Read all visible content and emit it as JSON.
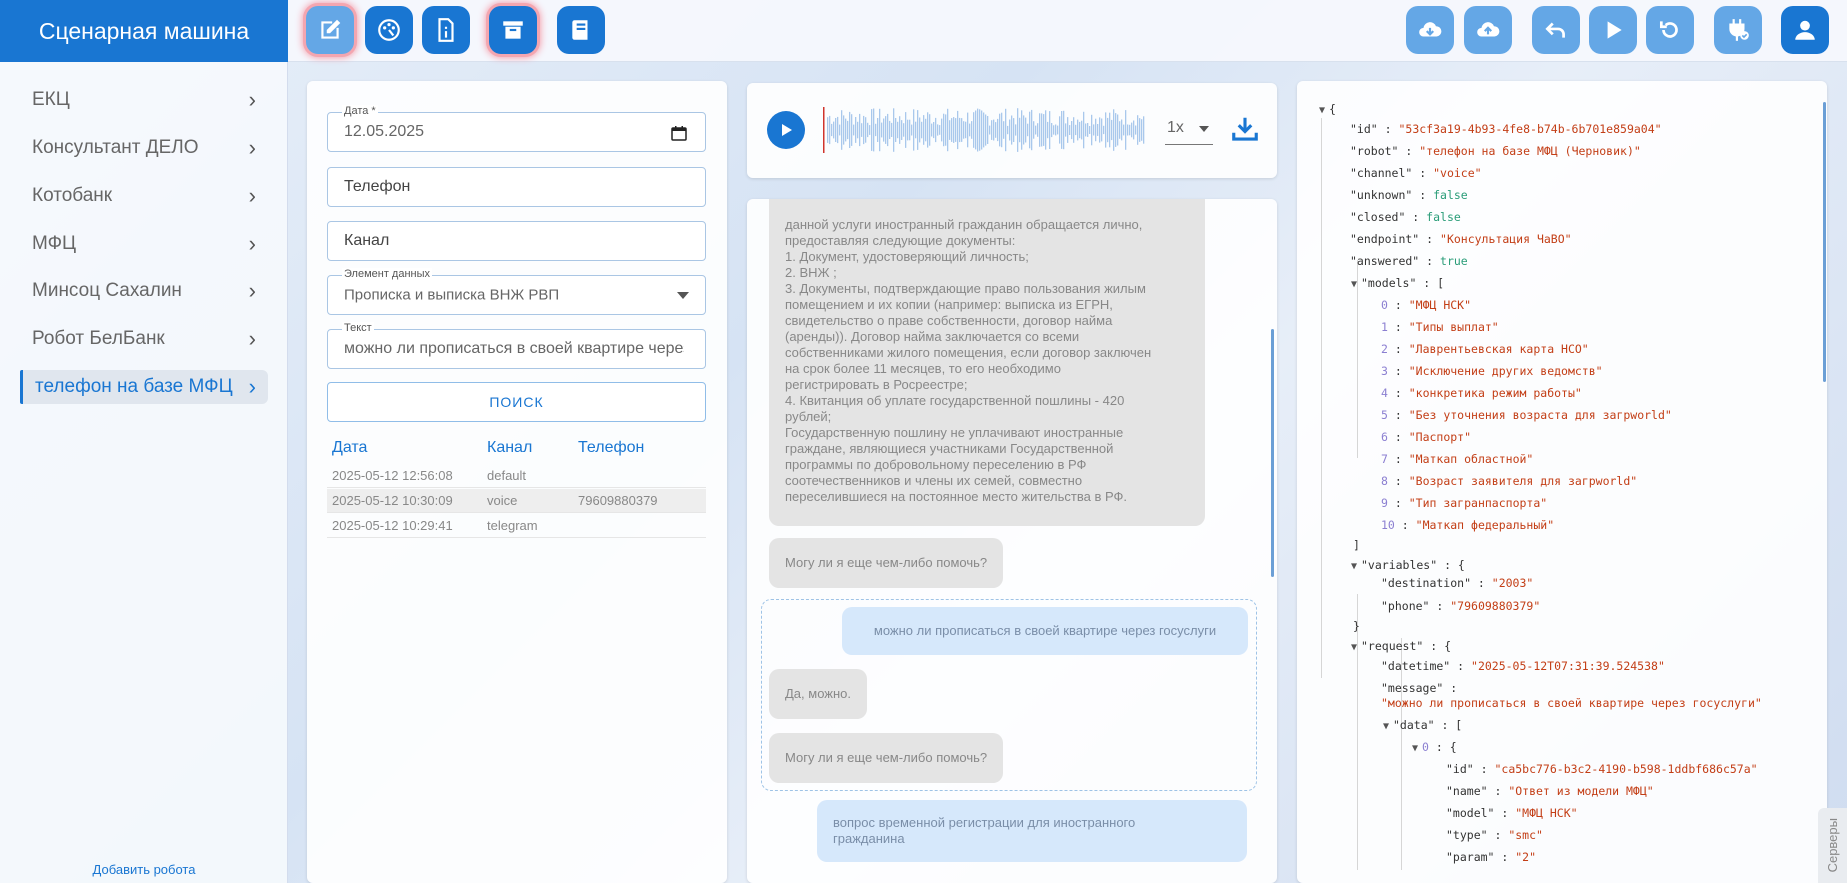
{
  "app": {
    "title": "Сценарная машина"
  },
  "sidebar": {
    "items": [
      {
        "label": "ЕКЦ"
      },
      {
        "label": "Консультант ДЕЛО"
      },
      {
        "label": "Котобанк"
      },
      {
        "label": "МФЦ"
      },
      {
        "label": "Минсоц Сахалин"
      },
      {
        "label": "Робот БелБанк"
      },
      {
        "label": "телефон на базе МФЦ"
      }
    ],
    "add_robot": "Добавить робота"
  },
  "filters": {
    "date_label": "Дата *",
    "date_value": "12.05.2025",
    "phone_placeholder": "Телефон",
    "channel_placeholder": "Канал",
    "data_element_label": "Элемент данных",
    "data_element_value": "Прописка и выписка ВНЖ РВП",
    "text_label": "Текст",
    "text_value": "можно ли прописаться в своей квартире через",
    "search_button": "ПОИСК"
  },
  "table": {
    "headers": {
      "date": "Дата",
      "channel": "Канал",
      "phone": "Телефон"
    },
    "rows": [
      {
        "date": "2025-05-12 12:56:08",
        "channel": "default",
        "phone": ""
      },
      {
        "date": "2025-05-12 10:30:09",
        "channel": "voice",
        "phone": "79609880379"
      },
      {
        "date": "2025-05-12 10:29:41",
        "channel": "telegram",
        "phone": ""
      }
    ]
  },
  "player": {
    "speed": "1x"
  },
  "chat": {
    "messages": [
      {
        "from": "bot",
        "text": "данной услуги иностранный гражданин обращается лично,\nпредоставляя следующие документы:\n1. Документ, удостоверяющий личность;\n2. ВНЖ ;\n3. Документы, подтверждающие право пользования жилым\nпомещением и их копии (например: выписка из ЕГРН,\nсвидетельство о праве собственности, договор найма\n(аренды)). Договор найма заключается со всеми\nсобственниками жилого помещения, если договор заключен\nна срок более 11 месяцев, то его необходимо\nрегистрировать в Росреестре;\n4. Квитанция об уплате государственной пошлины - 420\nрублей;\nГосударственную пошлину не уплачивают иностранные\nграждане, являющиеся участниками Государственной\nпрограммы по добровольному переселению в РФ\nсоотечественников и члены их семей, совместно\nпереселившиеся на постоянное место жительства в РФ."
      },
      {
        "from": "bot",
        "text": "Могу ли я еще чем-либо помочь?"
      },
      {
        "from": "user",
        "text": "можно ли прописаться в своей квартире через госуслуги"
      },
      {
        "from": "bot",
        "text": "Да, можно."
      },
      {
        "from": "bot",
        "text": "Могу ли я еще чем-либо помочь?"
      },
      {
        "from": "user",
        "text": "вопрос временной регистрации для иностранного\nгражданина"
      }
    ]
  },
  "json_view": {
    "brace_open": "{",
    "id": "\"53cf3a19-4b93-4fe8-b74b-6b701e859a04\"",
    "robot": "\"телефон на базе МФЦ (Черновик)\"",
    "channel": "\"voice\"",
    "unknown": "false",
    "closed": "false",
    "endpoint": "\"Консультация ЧаВО\"",
    "answered": "true",
    "models": [
      "\"МФЦ НСК\"",
      "\"Типы выплат\"",
      "\"Лаврентьевская карта НСО\"",
      "\"Исключение других ведомств\"",
      "\"конкретика режим работы\"",
      "\"Без уточнения возраста для загрworld\"",
      "\"Паспорт\"",
      "\"Маткап областной\"",
      "\"Возраст заявителя для загрworld\"",
      "\"Тип загранпаспорта\"",
      "\"Маткап федеральный\""
    ],
    "destination": "\"2003\"",
    "phone": "\"79609880379\"",
    "datetime": "\"2025-05-12T07:31:39.524538\"",
    "message": "\"можно ли прописаться в своей квартире через госуслуги\"",
    "data_id": "\"ca5bc776-b3c2-4190-b598-1ddbf686c57a\"",
    "data_name": "\"Ответ из модели МФЦ\"",
    "data_model": "\"МФЦ НСК\"",
    "data_type": "\"smc\"",
    "data_param": "\"2\""
  },
  "servers_tab": "Серверы"
}
